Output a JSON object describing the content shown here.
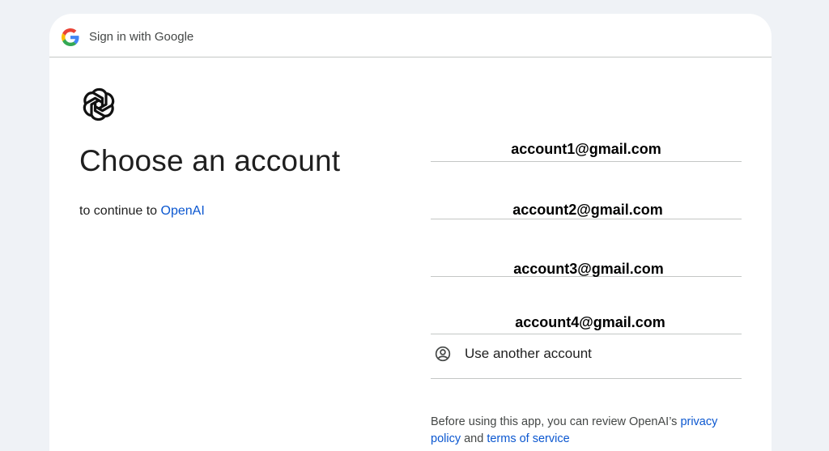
{
  "header": {
    "title": "Sign in with Google"
  },
  "icons": {
    "google": "google-g-icon",
    "app": "openai-logo-icon",
    "person": "person-circle-icon"
  },
  "main": {
    "heading": "Choose an account",
    "subtitle_prefix": "to continue to ",
    "subtitle_link": "OpenAI"
  },
  "accounts": [
    {
      "email": "account1@gmail.com"
    },
    {
      "email": "account2@gmail.com"
    },
    {
      "email": "account3@gmail.com"
    },
    {
      "email": "account4@gmail.com"
    }
  ],
  "use_another": {
    "label": "Use another account"
  },
  "footer": {
    "text_prefix": "Before using this app, you can review OpenAI’s ",
    "privacy_link": "privacy policy",
    "and": " and ",
    "terms_link": "terms of service"
  },
  "colors": {
    "link": "#0b57d0",
    "background": "#eff2f6",
    "divider": "#c4c7c5"
  }
}
